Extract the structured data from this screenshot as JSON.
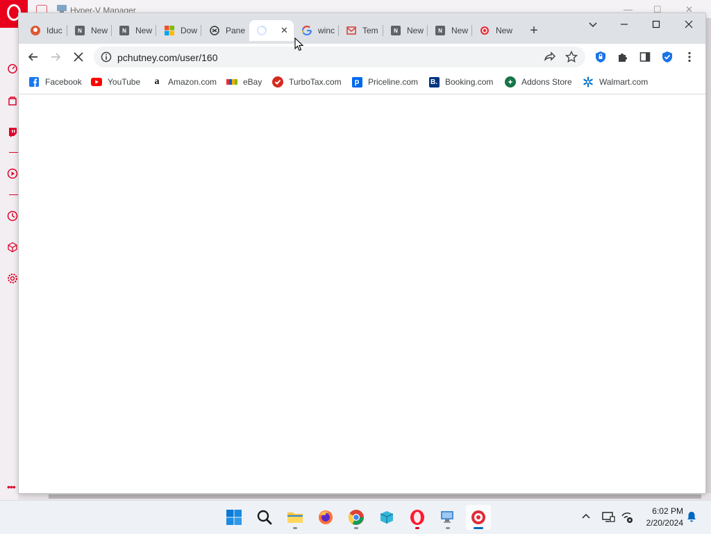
{
  "background_window": {
    "title": "Hyper-V Manager"
  },
  "browser": {
    "tabs": [
      {
        "title": "Iduc",
        "icon": "duckduckgo-icon"
      },
      {
        "title": "New",
        "icon": "notion-icon"
      },
      {
        "title": "New",
        "icon": "notion-icon"
      },
      {
        "title": "Dow",
        "icon": "microsoft-icon"
      },
      {
        "title": "Pane",
        "icon": "panel-icon"
      },
      {
        "title": "",
        "icon": "loading-spinner-icon",
        "active": true
      },
      {
        "title": "winc",
        "icon": "google-icon"
      },
      {
        "title": "Tem",
        "icon": "mail-icon"
      },
      {
        "title": "New",
        "icon": "notion-icon"
      },
      {
        "title": "New",
        "icon": "notion-icon"
      },
      {
        "title": "New",
        "icon": "opera-red-icon"
      }
    ],
    "url": "pchutney.com/user/160",
    "bookmarks": [
      {
        "label": "Facebook",
        "icon": "facebook-icon"
      },
      {
        "label": "YouTube",
        "icon": "youtube-icon"
      },
      {
        "label": "Amazon.com",
        "icon": "amazon-icon"
      },
      {
        "label": "eBay",
        "icon": "ebay-icon"
      },
      {
        "label": "TurboTax.com",
        "icon": "turbotax-icon"
      },
      {
        "label": "Priceline.com",
        "icon": "priceline-icon"
      },
      {
        "label": "Booking.com",
        "icon": "booking-icon"
      },
      {
        "label": "Addons Store",
        "icon": "addons-icon"
      },
      {
        "label": "Walmart.com",
        "icon": "walmart-icon"
      }
    ]
  },
  "taskbar": {
    "apps": [
      "windows-start-icon",
      "search-icon",
      "file-explorer-icon",
      "firefox-icon",
      "chrome-icon",
      "app-icon",
      "opera-icon",
      "hyperv-icon",
      "red-app-icon"
    ],
    "time": "6:02 PM",
    "date": "2/20/2024"
  },
  "colors": {
    "opera_red": "#e8001d",
    "chrome_tabstrip": "#dee1e6",
    "accent_blue": "#1a73e8"
  }
}
